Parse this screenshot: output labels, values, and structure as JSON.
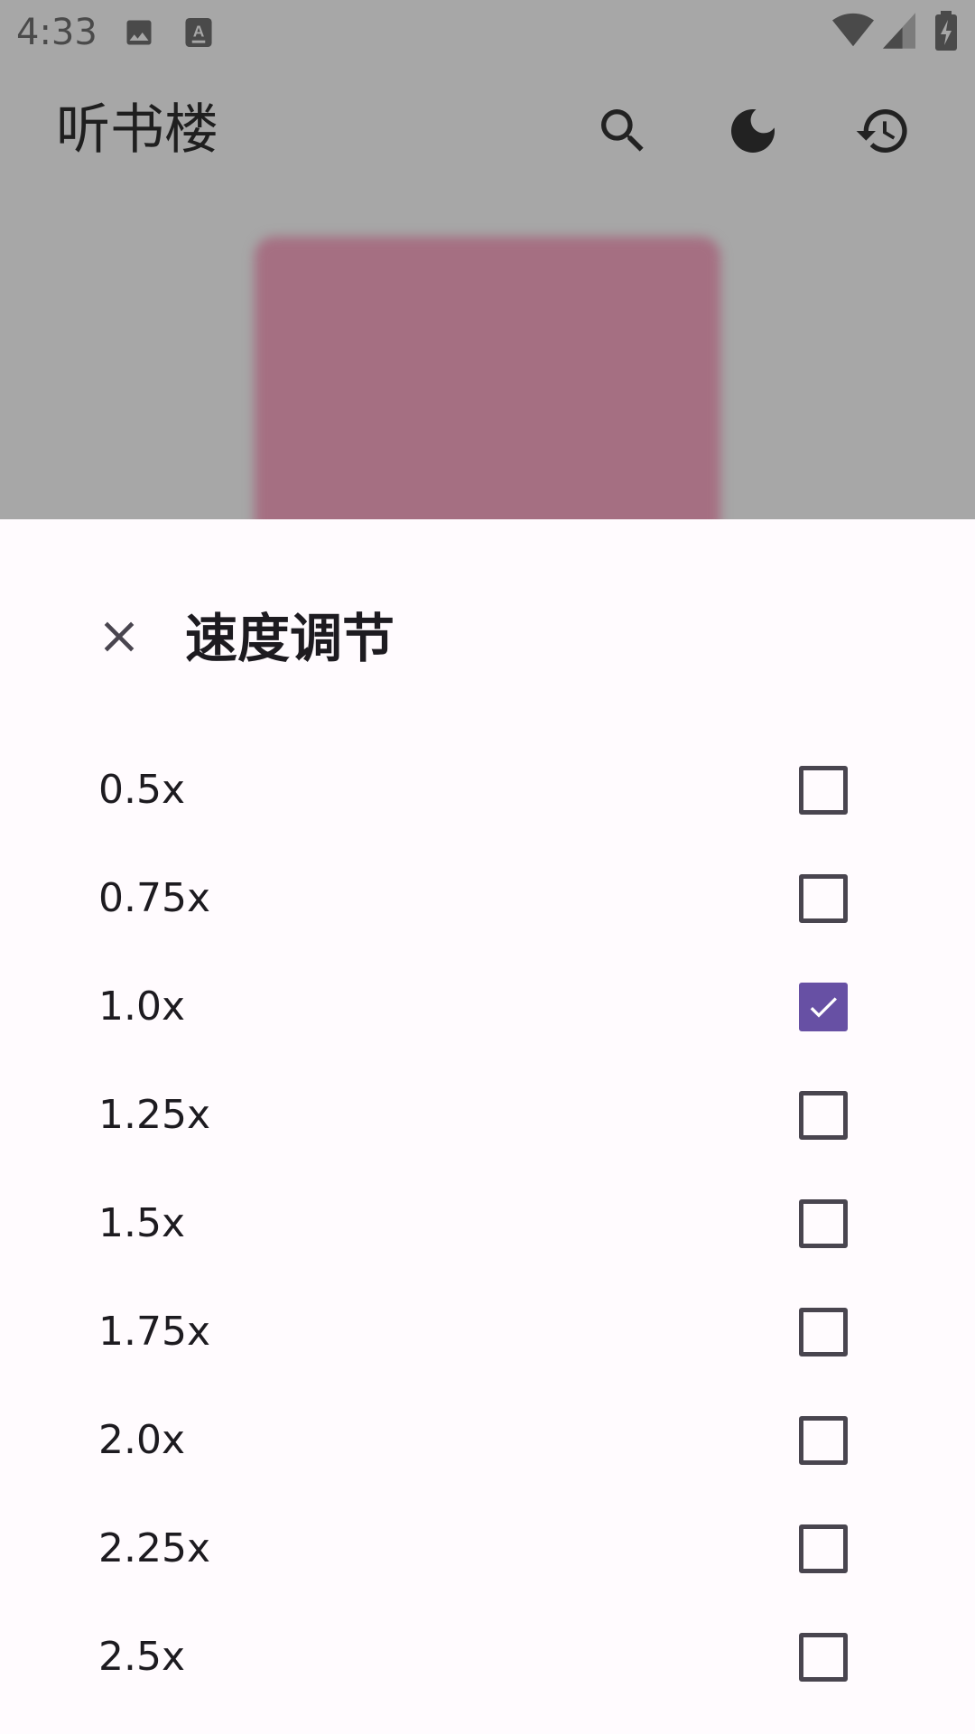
{
  "status_bar": {
    "time": "4:33",
    "icons": [
      "image-icon",
      "text-notification-icon",
      "wifi-icon",
      "signal-icon",
      "battery-charging-icon"
    ]
  },
  "app_bar": {
    "title": "听书楼",
    "actions": [
      "search-icon",
      "dark-mode-icon",
      "history-icon"
    ]
  },
  "sheet": {
    "title": "速度调节",
    "close_icon": "close-icon",
    "options": [
      {
        "label": "0.5x",
        "checked": false
      },
      {
        "label": "0.75x",
        "checked": false
      },
      {
        "label": "1.0x",
        "checked": true
      },
      {
        "label": "1.25x",
        "checked": false
      },
      {
        "label": "1.5x",
        "checked": false
      },
      {
        "label": "1.75x",
        "checked": false
      },
      {
        "label": "2.0x",
        "checked": false
      },
      {
        "label": "2.25x",
        "checked": false
      },
      {
        "label": "2.5x",
        "checked": false
      }
    ],
    "accent_color": "#6750A4"
  }
}
